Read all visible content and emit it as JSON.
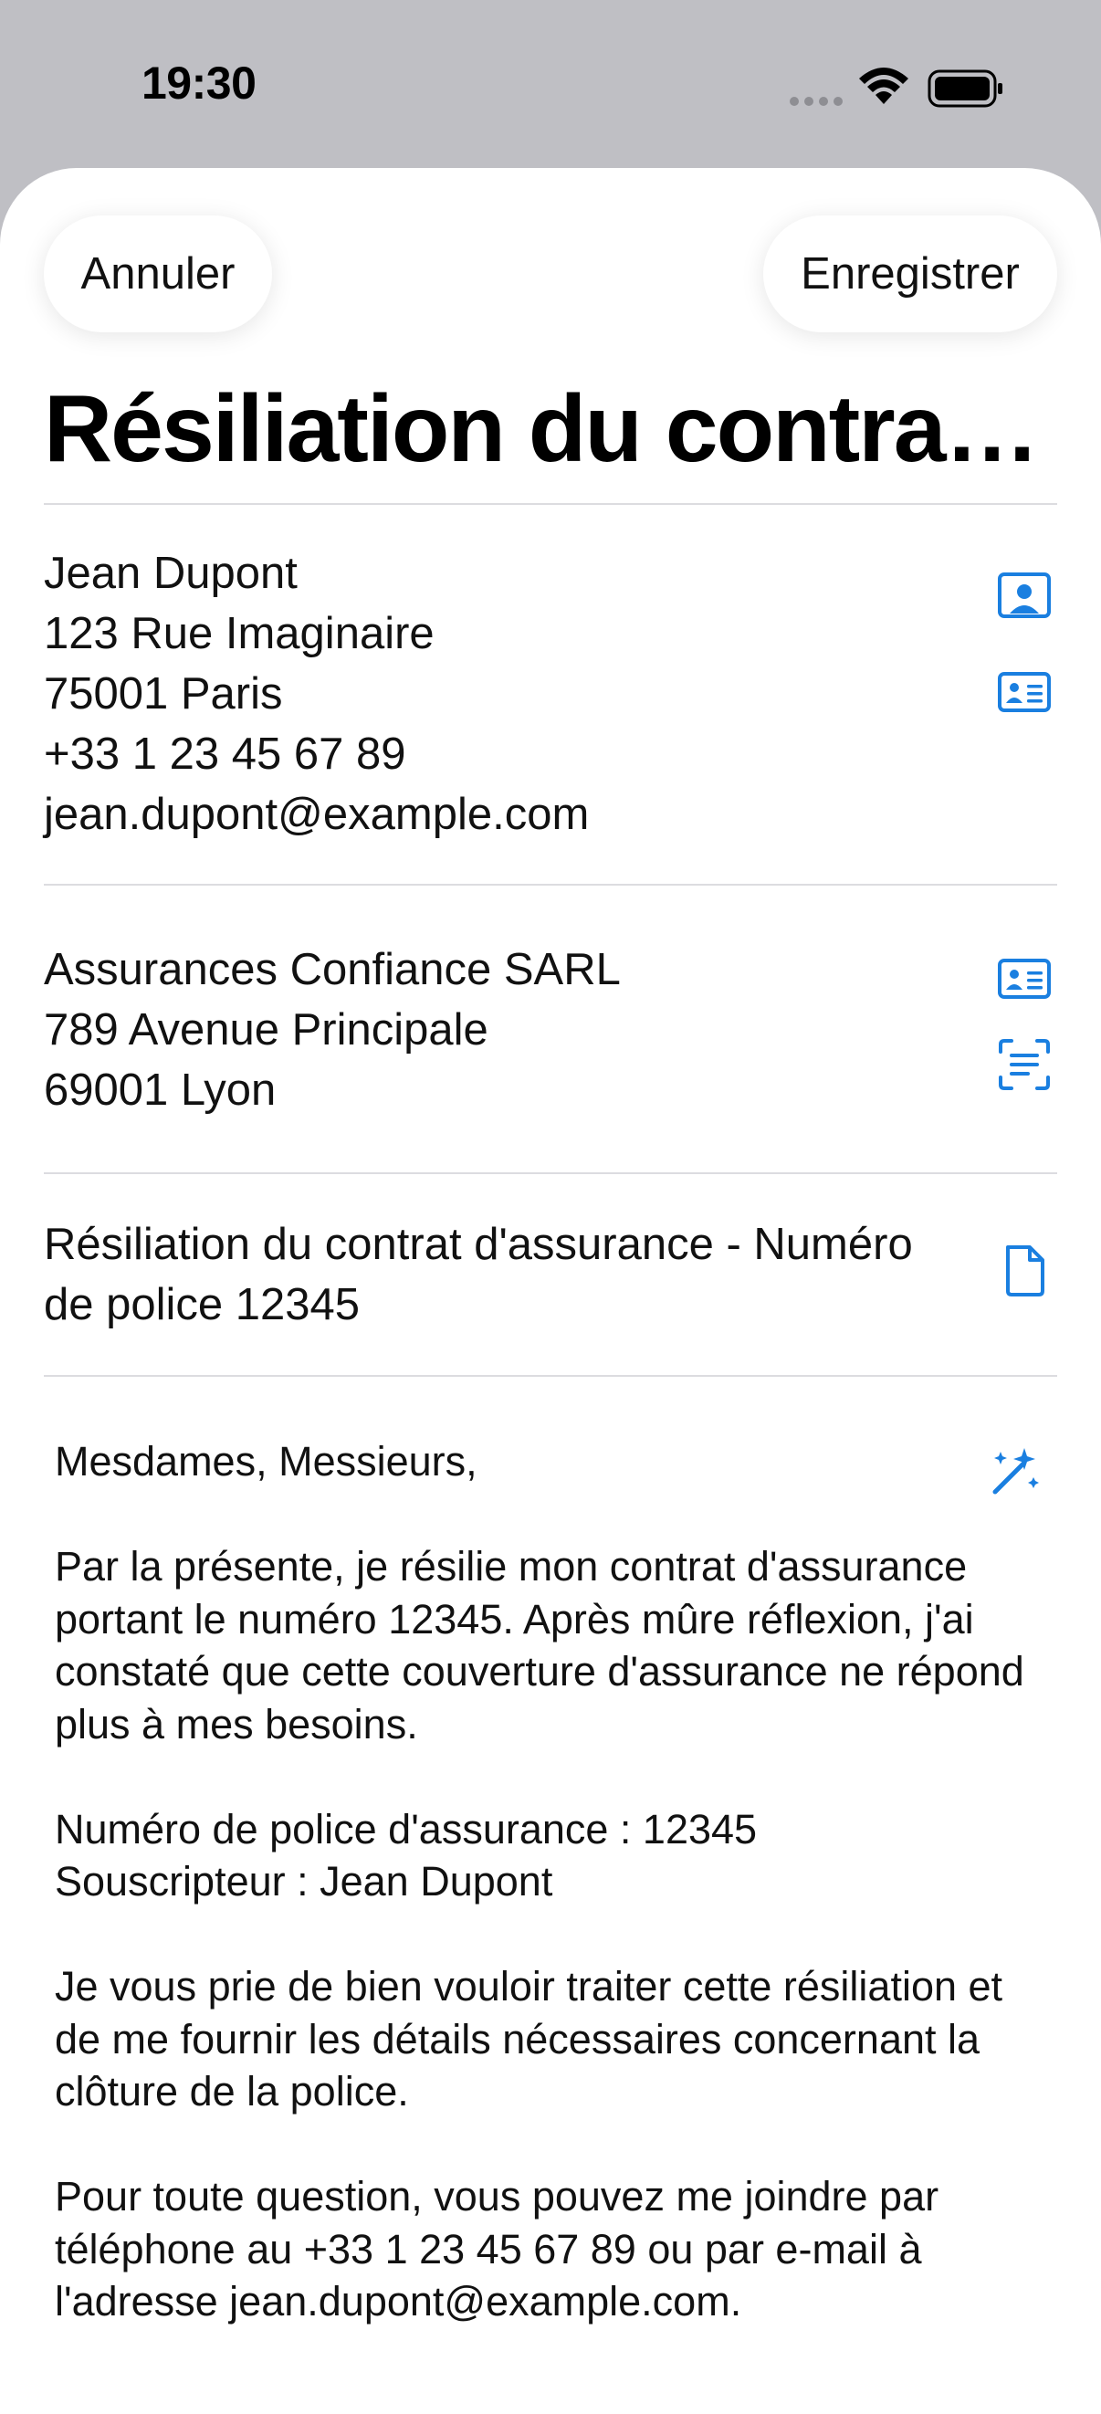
{
  "status_bar": {
    "time": "19:30"
  },
  "header": {
    "cancel_label": "Annuler",
    "save_label": "Enregistrer",
    "title": "Résiliation du contrat d'assurance"
  },
  "sender": {
    "name": "Jean Dupont",
    "street": "123 Rue Imaginaire",
    "city": "75001 Paris",
    "phone": "+33 1 23 45 67 89",
    "email": "jean.dupont@example.com"
  },
  "recipient": {
    "company": "Assurances Confiance SARL",
    "street": "789 Avenue Principale",
    "city": "69001 Lyon"
  },
  "subject": {
    "line1": "Résiliation du contrat d'assurance - Numéro",
    "line2": "de police 12345"
  },
  "letter": {
    "salutation": "Mesdames, Messieurs,",
    "paragraph1": "Par la présente, je résilie mon contrat d'assurance portant le numéro 12345. Après mûre réflexion, j'ai constaté que cette couverture d'assurance ne répond plus à mes besoins.",
    "policy_line": "Numéro de police d'assurance : 12345",
    "holder_line": "Souscripteur : Jean Dupont",
    "paragraph3": "Je vous prie de bien vouloir traiter cette résiliation et de me fournir les détails nécessaires concernant la clôture de la police.",
    "paragraph4": "Pour toute question, vous pouvez me joindre par téléphone au +33 1 23 45 67 89 ou par e-mail à l'adresse jean.dupont@example.com."
  },
  "colors": {
    "accent": "#1a7fe0",
    "sheet": "#ffffff",
    "backdrop": "#bfbfc4"
  },
  "icons": [
    "person-square-icon",
    "contact-card-icon",
    "contact-card-icon",
    "text-scan-icon",
    "document-icon",
    "magic-wand-icon"
  ]
}
